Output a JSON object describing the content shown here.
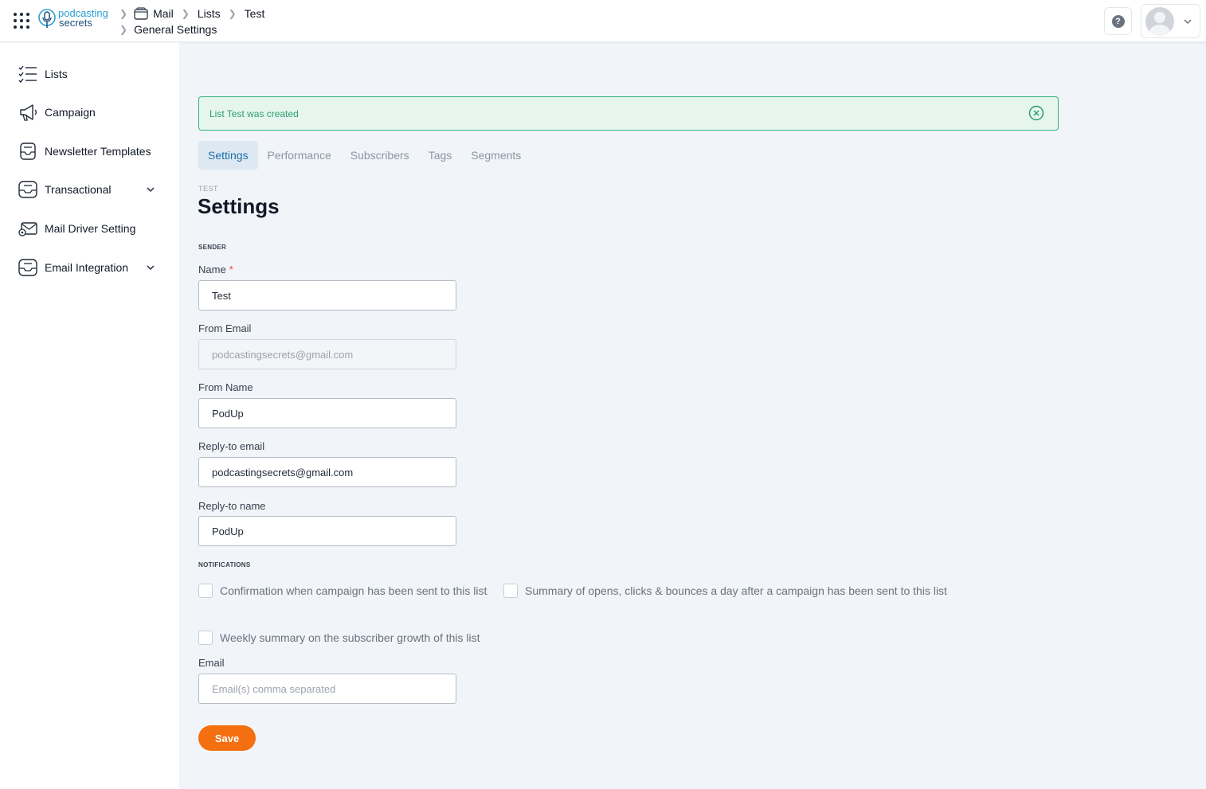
{
  "header": {
    "logo_line1": "podcasting",
    "logo_line2": "secrets",
    "breadcrumb": [
      "Mail",
      "Lists",
      "Test",
      "General Settings"
    ],
    "help_label": "?"
  },
  "sidebar": {
    "items": [
      {
        "label": "Lists",
        "icon": "checklist-icon"
      },
      {
        "label": "Campaign",
        "icon": "megaphone-icon"
      },
      {
        "label": "Newsletter Templates",
        "icon": "template-icon"
      },
      {
        "label": "Transactional",
        "icon": "inbox-icon",
        "expandable": true
      },
      {
        "label": "Mail Driver Setting",
        "icon": "mail-driver-icon"
      },
      {
        "label": "Email Integration",
        "icon": "inbox-icon",
        "expandable": true
      }
    ]
  },
  "alert": {
    "message": "List Test was created",
    "color": "#34b27b"
  },
  "tabs": [
    {
      "label": "Settings",
      "active": true
    },
    {
      "label": "Performance"
    },
    {
      "label": "Subscribers"
    },
    {
      "label": "Tags"
    },
    {
      "label": "Segments"
    }
  ],
  "page": {
    "eyebrow": "TEST",
    "title": "Settings"
  },
  "sender": {
    "section": "SENDER",
    "name_label": "Name",
    "name_required": "*",
    "name_value": "Test",
    "from_email_label": "From Email",
    "from_email_placeholder": "podcastingsecrets@gmail.com",
    "from_name_label": "From Name",
    "from_name_value": "PodUp",
    "reply_email_label": "Reply-to email",
    "reply_email_value": "podcastingsecrets@gmail.com",
    "reply_name_label": "Reply-to name",
    "reply_name_value": "PodUp"
  },
  "notifications": {
    "section": "NOTIFICATIONS",
    "options": [
      "Confirmation when campaign has been sent to this list",
      "Summary of opens, clicks & bounces a day after a campaign has been sent to this list",
      "Weekly summary on the subscriber growth of this list"
    ],
    "email_label": "Email",
    "email_placeholder": "Email(s) comma separated"
  },
  "actions": {
    "save_label": "Save",
    "save_color": "#f36f10"
  }
}
